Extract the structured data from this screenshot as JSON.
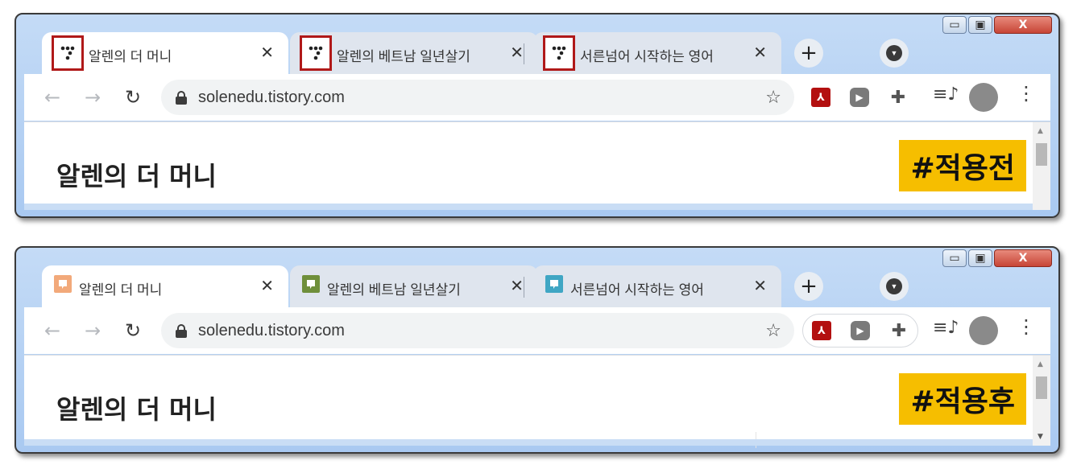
{
  "before": {
    "tabs": [
      {
        "title": "알렌의 더 머니",
        "favicon": "tistory-dots-icon"
      },
      {
        "title": "알렌의 베트남 일년살기",
        "favicon": "tistory-dots-icon"
      },
      {
        "title": "서른넘어 시작하는 영어",
        "favicon": "tistory-dots-icon"
      }
    ],
    "url": "solenedu.tistory.com",
    "page_heading": "알렌의 더 머니",
    "badge": "#적용전"
  },
  "after": {
    "tabs": [
      {
        "title": "알렌의 더 머니",
        "favicon": "speech-bubble-icon",
        "favicon_color": "#f2a97a"
      },
      {
        "title": "알렌의 베트남 일년살기",
        "favicon": "speech-bubble-icon",
        "favicon_color": "#6f8f3b"
      },
      {
        "title": "서른넘어 시작하는 영어",
        "favicon": "speech-bubble-icon",
        "favicon_color": "#3fa6c4"
      }
    ],
    "url": "solenedu.tistory.com",
    "page_heading": "알렌의 더 머니",
    "badge": "#적용후"
  },
  "icons": {
    "close": "✕",
    "new_tab": "+",
    "back": "←",
    "forward": "→",
    "reload": "↻",
    "star": "☆",
    "pdf": "⅄",
    "play": "▶",
    "puzzle": "✚",
    "queue": "≡♪",
    "menu": "⋮",
    "tab_search": "▼",
    "minimize": "▭",
    "maximize": "▣",
    "window_close": "X",
    "scroll_up": "▲",
    "scroll_down": "▼"
  },
  "colors": {
    "highlight_border": "#b01919",
    "badge_bg": "#f6be00"
  }
}
